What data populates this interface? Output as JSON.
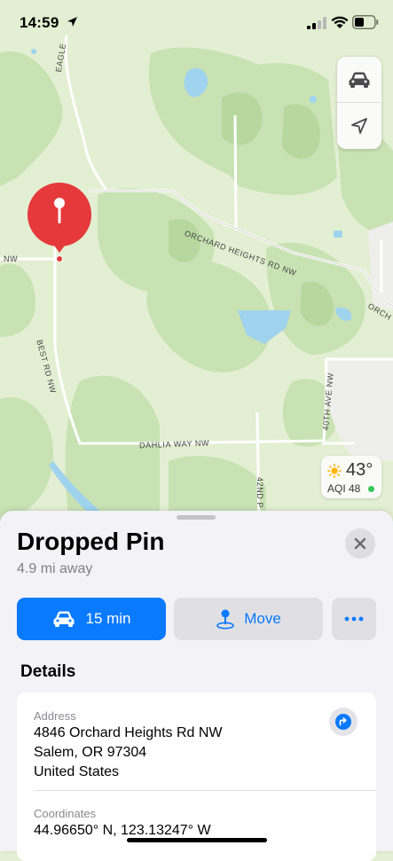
{
  "status_bar": {
    "time": "14:59"
  },
  "map": {
    "roads": {
      "eagle": "EAGLE",
      "nw": "NW",
      "orchard": "ORCHARD HEIGHTS RD NW",
      "orch": "ORCH",
      "best": "BEST RD NW",
      "ave40": "40TH AVE NW",
      "dahlia": "DAHLIA WAY NW",
      "p42": "42ND P"
    },
    "weather": {
      "temperature": "43°",
      "aqi": "AQI 48"
    },
    "controls": {
      "top_icon": "car-icon",
      "bottom_icon": "location-arrow-icon"
    },
    "pin_color": "#e5393c"
  },
  "sheet": {
    "title": "Dropped Pin",
    "distance": "4.9 mi away",
    "actions": {
      "drive_label": "15 min",
      "move_label": "Move",
      "more_icon": "ellipsis-icon"
    },
    "details_heading": "Details",
    "address_label": "Address",
    "address_lines": [
      "4846 Orchard Heights Rd NW",
      "Salem, OR  97304",
      "United States"
    ],
    "coordinates_label": "Coordinates",
    "coordinates_value": "44.96650° N, 123.13247° W"
  },
  "colors": {
    "accent": "#0a7aff",
    "aqi_good": "#35c759"
  }
}
